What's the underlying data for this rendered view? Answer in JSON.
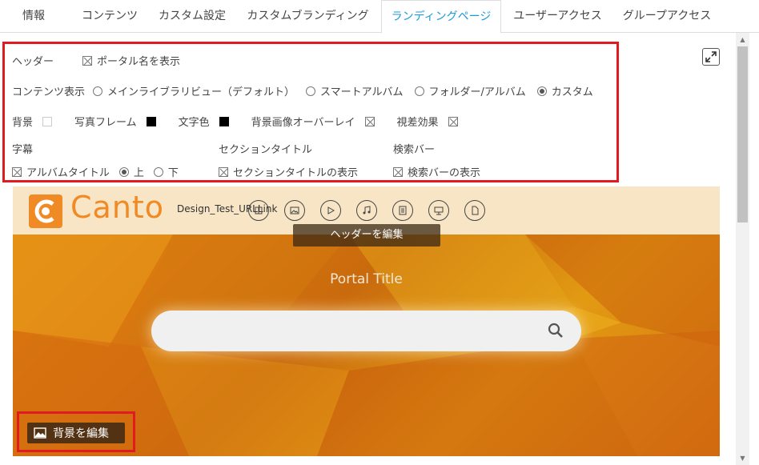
{
  "tabs": [
    {
      "label": "情報"
    },
    {
      "label": "コンテンツ"
    },
    {
      "label": "カスタム設定"
    },
    {
      "label": "カスタムブランディング"
    },
    {
      "label": "ランディングページ"
    },
    {
      "label": "ユーザーアクセス"
    },
    {
      "label": "グループアクセス"
    }
  ],
  "active_tab": "ランディングページ",
  "settings": {
    "header_label": "ヘッダー",
    "show_portal_name": "ポータル名を表示",
    "content_display_label": "コンテンツ表示",
    "content_options": [
      "メインライブラリビュー（デフォルト）",
      "スマートアルバム",
      "フォルダー/アルバム",
      "カスタム"
    ],
    "content_selected": "カスタム",
    "background_label": "背景",
    "photo_frame_label": "写真フレーム",
    "text_color_label": "文字色",
    "overlay_label": "背景画像オーバーレイ",
    "parallax_label": "視差効果",
    "caption_label": "字幕",
    "album_title_label": "アルバムタイトル",
    "position_top": "上",
    "position_bottom": "下",
    "position_selected": "上",
    "section_title_label": "セクションタイトル",
    "show_section_title": "セクションタイトルの表示",
    "search_bar_label": "検索バー",
    "show_search_bar": "検索バーの表示"
  },
  "preview": {
    "logo_text": "Canto",
    "portal_name": "Design_Test_URLLink",
    "edit_header_label": "ヘッダーを編集",
    "portal_title": "Portal Title",
    "edit_background_label": "背景を編集",
    "header_icons": [
      "all-icon",
      "image-icon",
      "video-icon",
      "audio-icon",
      "document-icon",
      "presentation-icon",
      "file-icon"
    ]
  },
  "colors": {
    "accent": "#1a9bd7",
    "highlight_border": "#e11b22",
    "brand_orange": "#f08a24"
  }
}
